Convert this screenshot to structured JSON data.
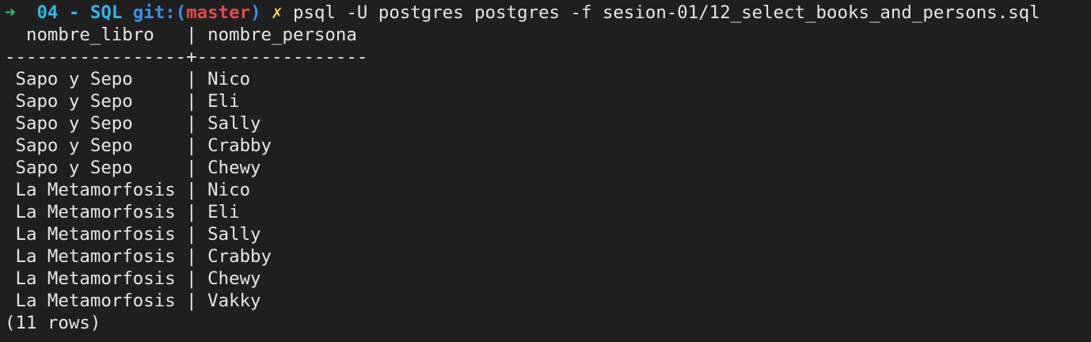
{
  "prompt": {
    "arrow": "➜",
    "directory": "04 - SQL",
    "git_label": "git:(",
    "branch": "master",
    "git_close": ")",
    "dirty_mark": "✗",
    "command": "psql -U postgres postgres -f sesion-01/12_select_books_and_persons.sql"
  },
  "table": {
    "header": "  nombre_libro   | nombre_persona",
    "separator": "-----------------+----------------",
    "rows": [
      " Sapo y Sepo     | Nico",
      " Sapo y Sepo     | Eli",
      " Sapo y Sepo     | Sally",
      " Sapo y Sepo     | Crabby",
      " Sapo y Sepo     | Chewy",
      " La Metamorfosis | Nico",
      " La Metamorfosis | Eli",
      " La Metamorfosis | Sally",
      " La Metamorfosis | Crabby",
      " La Metamorfosis | Chewy",
      " La Metamorfosis | Vakky"
    ],
    "footer": "(11 rows)"
  },
  "colors": {
    "background": "#1f1f1f",
    "arrow": "#2fbf71",
    "directory": "#36b5e6",
    "git": "#3e8fe8",
    "branch": "#e5484d",
    "dirty": "#f1d44a",
    "text": "#e6e6e6"
  }
}
